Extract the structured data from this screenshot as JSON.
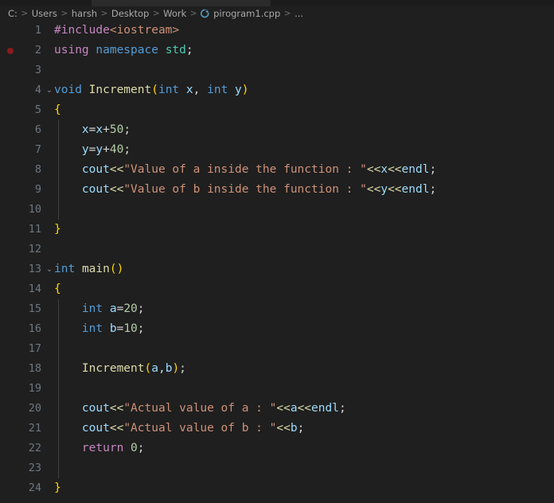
{
  "window": {
    "app": "Visual Studio Code",
    "theme_background": "#1f1f1f"
  },
  "breadcrumb": {
    "name": "breadcrumb",
    "separator": ">",
    "file_icon": "cpp-file-icon",
    "items": [
      {
        "label": "C:"
      },
      {
        "label": "Users"
      },
      {
        "label": "harsh"
      },
      {
        "label": "Desktop"
      },
      {
        "label": "Work"
      },
      {
        "label": "pirogram1.cpp",
        "icon": "cpp-file-icon"
      },
      {
        "label": "..."
      }
    ]
  },
  "editor": {
    "language": "cpp",
    "filename": "pirogram1.cpp",
    "line_count": 24,
    "breakpoint_lines": [
      2
    ],
    "folding_lines": [
      4,
      13
    ],
    "colors": {
      "background": "#1f1f1f",
      "line_number": "#6e7681",
      "text": "#d4d4d4",
      "keyword": "#569cd6",
      "preprocessor": "#c586c0",
      "string": "#ce9178",
      "number": "#b5cea8",
      "function": "#dcdcaa",
      "variable": "#9cdcfe",
      "type": "#4ec9b0",
      "bracket": "#ffd700",
      "breakpoint": "#8b1a1a",
      "indent_guide": "#404040"
    },
    "lines": [
      {
        "n": "1",
        "text": "#include<iostream>"
      },
      {
        "n": "2",
        "text": "using namespace std;"
      },
      {
        "n": "3",
        "text": ""
      },
      {
        "n": "4",
        "text": "void Increment(int x, int y)"
      },
      {
        "n": "5",
        "text": "{"
      },
      {
        "n": "6",
        "text": "    x=x+50;"
      },
      {
        "n": "7",
        "text": "    y=y+40;"
      },
      {
        "n": "8",
        "text": "    cout<<\"Value of a inside the function : \"<<x<<endl;"
      },
      {
        "n": "9",
        "text": "    cout<<\"Value of b inside the function : \"<<y<<endl;"
      },
      {
        "n": "10",
        "text": ""
      },
      {
        "n": "11",
        "text": "}"
      },
      {
        "n": "12",
        "text": ""
      },
      {
        "n": "13",
        "text": "int main()"
      },
      {
        "n": "14",
        "text": "{"
      },
      {
        "n": "15",
        "text": "    int a=20;"
      },
      {
        "n": "16",
        "text": "    int b=10;"
      },
      {
        "n": "17",
        "text": ""
      },
      {
        "n": "18",
        "text": "    Increment(a,b);"
      },
      {
        "n": "19",
        "text": ""
      },
      {
        "n": "20",
        "text": "    cout<<\"Actual value of a : \"<<a<<endl;"
      },
      {
        "n": "21",
        "text": "    cout<<\"Actual value of b : \"<<b;"
      },
      {
        "n": "22",
        "text": "    return 0;"
      },
      {
        "n": "23",
        "text": ""
      },
      {
        "n": "24",
        "text": "}"
      }
    ],
    "tokens": [
      [
        {
          "t": "#include",
          "c": "t-pre"
        },
        {
          "t": "<iostream>",
          "c": "t-hdr"
        }
      ],
      [
        {
          "t": "using",
          "c": "t-pre"
        },
        {
          "t": " ",
          "c": "t-plain"
        },
        {
          "t": "namespace",
          "c": "t-kw"
        },
        {
          "t": " ",
          "c": "t-plain"
        },
        {
          "t": "std",
          "c": "t-type"
        },
        {
          "t": ";",
          "c": "t-op"
        }
      ],
      [],
      [
        {
          "t": "void",
          "c": "t-kw"
        },
        {
          "t": " ",
          "c": "t-plain"
        },
        {
          "t": "Increment",
          "c": "t-fn"
        },
        {
          "t": "(",
          "c": "t-br1"
        },
        {
          "t": "int",
          "c": "t-kw"
        },
        {
          "t": " ",
          "c": "t-plain"
        },
        {
          "t": "x",
          "c": "t-var"
        },
        {
          "t": ", ",
          "c": "t-op"
        },
        {
          "t": "int",
          "c": "t-kw"
        },
        {
          "t": " ",
          "c": "t-plain"
        },
        {
          "t": "y",
          "c": "t-var"
        },
        {
          "t": ")",
          "c": "t-br1"
        }
      ],
      [
        {
          "t": "{",
          "c": "t-br1"
        }
      ],
      [
        {
          "t": "    ",
          "c": "t-plain"
        },
        {
          "t": "x",
          "c": "t-var"
        },
        {
          "t": "=",
          "c": "t-op"
        },
        {
          "t": "x",
          "c": "t-var"
        },
        {
          "t": "+",
          "c": "t-op"
        },
        {
          "t": "50",
          "c": "t-num"
        },
        {
          "t": ";",
          "c": "t-op"
        }
      ],
      [
        {
          "t": "    ",
          "c": "t-plain"
        },
        {
          "t": "y",
          "c": "t-var"
        },
        {
          "t": "=",
          "c": "t-op"
        },
        {
          "t": "y",
          "c": "t-var"
        },
        {
          "t": "+",
          "c": "t-op"
        },
        {
          "t": "40",
          "c": "t-num"
        },
        {
          "t": ";",
          "c": "t-op"
        }
      ],
      [
        {
          "t": "    ",
          "c": "t-plain"
        },
        {
          "t": "cout",
          "c": "t-var"
        },
        {
          "t": "<<",
          "c": "t-shift"
        },
        {
          "t": "\"Value of a inside the function : \"",
          "c": "t-str"
        },
        {
          "t": "<<",
          "c": "t-shift"
        },
        {
          "t": "x",
          "c": "t-var"
        },
        {
          "t": "<<",
          "c": "t-shift"
        },
        {
          "t": "endl",
          "c": "t-var"
        },
        {
          "t": ";",
          "c": "t-op"
        }
      ],
      [
        {
          "t": "    ",
          "c": "t-plain"
        },
        {
          "t": "cout",
          "c": "t-var"
        },
        {
          "t": "<<",
          "c": "t-shift"
        },
        {
          "t": "\"Value of b inside the function : \"",
          "c": "t-str"
        },
        {
          "t": "<<",
          "c": "t-shift"
        },
        {
          "t": "y",
          "c": "t-var"
        },
        {
          "t": "<<",
          "c": "t-shift"
        },
        {
          "t": "endl",
          "c": "t-var"
        },
        {
          "t": ";",
          "c": "t-op"
        }
      ],
      [],
      [
        {
          "t": "}",
          "c": "t-br1"
        }
      ],
      [],
      [
        {
          "t": "int",
          "c": "t-kw"
        },
        {
          "t": " ",
          "c": "t-plain"
        },
        {
          "t": "main",
          "c": "t-fn"
        },
        {
          "t": "(",
          "c": "t-br1"
        },
        {
          "t": ")",
          "c": "t-br1"
        }
      ],
      [
        {
          "t": "{",
          "c": "t-br1"
        }
      ],
      [
        {
          "t": "    ",
          "c": "t-plain"
        },
        {
          "t": "int",
          "c": "t-kw"
        },
        {
          "t": " ",
          "c": "t-plain"
        },
        {
          "t": "a",
          "c": "t-var"
        },
        {
          "t": "=",
          "c": "t-op"
        },
        {
          "t": "20",
          "c": "t-num"
        },
        {
          "t": ";",
          "c": "t-op"
        }
      ],
      [
        {
          "t": "    ",
          "c": "t-plain"
        },
        {
          "t": "int",
          "c": "t-kw"
        },
        {
          "t": " ",
          "c": "t-plain"
        },
        {
          "t": "b",
          "c": "t-var"
        },
        {
          "t": "=",
          "c": "t-op"
        },
        {
          "t": "10",
          "c": "t-num"
        },
        {
          "t": ";",
          "c": "t-op"
        }
      ],
      [],
      [
        {
          "t": "    ",
          "c": "t-plain"
        },
        {
          "t": "Increment",
          "c": "t-fn"
        },
        {
          "t": "(",
          "c": "t-br1"
        },
        {
          "t": "a",
          "c": "t-var"
        },
        {
          "t": ",",
          "c": "t-op"
        },
        {
          "t": "b",
          "c": "t-var"
        },
        {
          "t": ")",
          "c": "t-br1"
        },
        {
          "t": ";",
          "c": "t-op"
        }
      ],
      [],
      [
        {
          "t": "    ",
          "c": "t-plain"
        },
        {
          "t": "cout",
          "c": "t-var"
        },
        {
          "t": "<<",
          "c": "t-shift"
        },
        {
          "t": "\"Actual value of a : \"",
          "c": "t-str"
        },
        {
          "t": "<<",
          "c": "t-shift"
        },
        {
          "t": "a",
          "c": "t-var"
        },
        {
          "t": "<<",
          "c": "t-shift"
        },
        {
          "t": "endl",
          "c": "t-var"
        },
        {
          "t": ";",
          "c": "t-op"
        }
      ],
      [
        {
          "t": "    ",
          "c": "t-plain"
        },
        {
          "t": "cout",
          "c": "t-var"
        },
        {
          "t": "<<",
          "c": "t-shift"
        },
        {
          "t": "\"Actual value of b : \"",
          "c": "t-str"
        },
        {
          "t": "<<",
          "c": "t-shift"
        },
        {
          "t": "b",
          "c": "t-var"
        },
        {
          "t": ";",
          "c": "t-op"
        }
      ],
      [
        {
          "t": "    ",
          "c": "t-plain"
        },
        {
          "t": "return",
          "c": "t-pre"
        },
        {
          "t": " ",
          "c": "t-plain"
        },
        {
          "t": "0",
          "c": "t-num"
        },
        {
          "t": ";",
          "c": "t-op"
        }
      ],
      [],
      [
        {
          "t": "}",
          "c": "t-br1"
        }
      ]
    ]
  }
}
